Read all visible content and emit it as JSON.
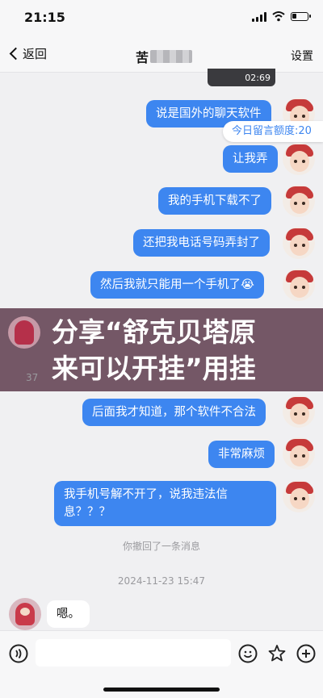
{
  "status_bar": {
    "time": "21:15"
  },
  "nav": {
    "back_label": "返回",
    "title": "苦",
    "settings_label": "设置"
  },
  "video_thumb": {
    "duration": "02:69"
  },
  "quota_tag": "今日留言额度:20",
  "messages": [
    {
      "side": "out",
      "text": "说是国外的聊天软件"
    },
    {
      "side": "out",
      "text": "让我弄"
    },
    {
      "side": "out",
      "text": "我的手机下载不了"
    },
    {
      "side": "out",
      "text": "还把我电话号码弄封了"
    },
    {
      "side": "out",
      "text": "然后我就只能用一个手机了😭"
    },
    {
      "side": "out",
      "text": "后面我才知道，那个软件不合法"
    },
    {
      "side": "out",
      "text": "非常麻烦"
    },
    {
      "side": "out",
      "text": "我手机号解不开了，说我违法信息？？？"
    },
    {
      "side": "in",
      "text": "嗯。"
    }
  ],
  "overlay": {
    "text_line1": "分享“舒克贝塔原",
    "text_line2": "来可以开挂”用挂"
  },
  "system": {
    "recall": "你撤回了一条消息",
    "timestamp": "2024-11-23 15:47",
    "partial_time": "37"
  },
  "colors": {
    "bubble_out": "#3d86f0",
    "bubble_in": "#ffffff",
    "overlay": "#745766",
    "background": "#f0f0f2"
  },
  "icons": [
    "voice-icon",
    "emoji-icon",
    "sticker-icon",
    "plus-icon"
  ]
}
